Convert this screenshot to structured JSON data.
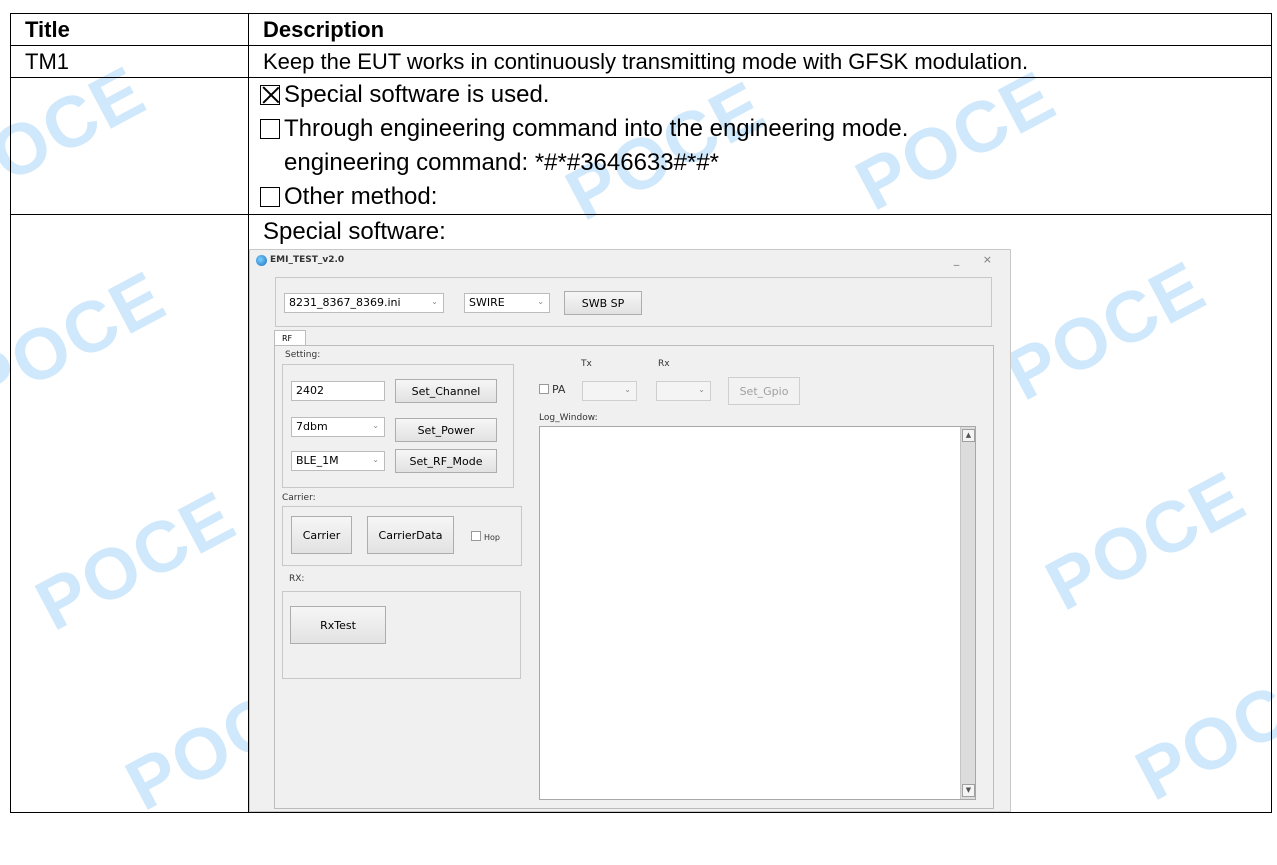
{
  "watermark_text": "POCE",
  "table": {
    "headers": [
      "Title",
      "Description"
    ],
    "row1": {
      "title": "TM1",
      "description": "Keep the EUT works in continuously transmitting mode with GFSK modulation."
    },
    "row2": {
      "options": [
        {
          "checked": true,
          "text": "Special software is used."
        },
        {
          "checked": false,
          "text": "Through engineering command into the engineering mode."
        }
      ],
      "engineering_command": "engineering command: *#*#3646633#*#*",
      "other": {
        "checked": false,
        "text": "Other method:"
      }
    },
    "row3": {
      "label": "Special software:"
    }
  },
  "app": {
    "window_title": "EMI_TEST_v2.0",
    "window_controls": "_ ×",
    "config_file": "8231_8367_8369.ini",
    "interface": "SWIRE",
    "swb_sp_button": "SWB SP",
    "tab_label": "RF",
    "setting_label": "Setting:",
    "channel_value": "2402",
    "set_channel_button": "Set_Channel",
    "power_value": "7dbm",
    "set_power_button": "Set_Power",
    "rf_mode_value": "BLE_1M",
    "set_rf_mode_button": "Set_RF_Mode",
    "carrier_label": "Carrier:",
    "carrier_button": "Carrier",
    "carrier_data_button": "CarrierData",
    "hop_label": "Hop",
    "rx_label": "RX:",
    "rx_test_button": "RxTest",
    "tx_label": "Tx",
    "rx_col_label": "Rx",
    "pa_label": "PA",
    "set_gpio_button": "Set_Gpio",
    "log_window_label": "Log_Window:"
  }
}
